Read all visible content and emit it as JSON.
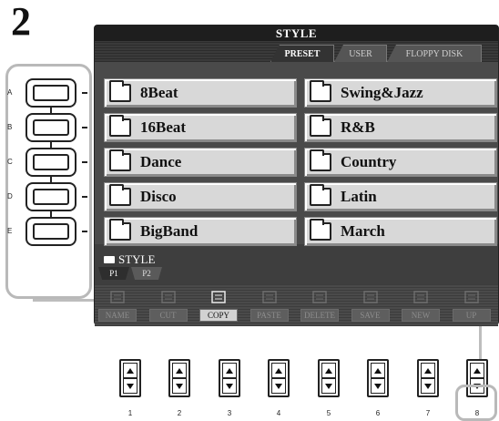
{
  "step": "2",
  "side_buttons": [
    {
      "letter": "A"
    },
    {
      "letter": "B"
    },
    {
      "letter": "C"
    },
    {
      "letter": "D"
    },
    {
      "letter": "E"
    }
  ],
  "screen": {
    "title": "STYLE",
    "tabs": [
      {
        "label": "PRESET",
        "active": true
      },
      {
        "label": "USER",
        "active": false
      },
      {
        "label": "FLOPPY DISK",
        "active": false
      }
    ],
    "styles_left": [
      "8Beat",
      "16Beat",
      "Dance",
      "Disco",
      "BigBand"
    ],
    "styles_right": [
      "Swing&Jazz",
      "R&B",
      "Country",
      "Latin",
      "March"
    ],
    "path": "STYLE",
    "pages": [
      {
        "label": "P1",
        "active": true
      },
      {
        "label": "P2",
        "active": false
      }
    ],
    "functions": [
      {
        "label": "NAME",
        "icon": "name-icon",
        "active": false
      },
      {
        "label": "CUT",
        "icon": "scissors-icon",
        "active": false
      },
      {
        "label": "COPY",
        "icon": "copy-icon",
        "active": true
      },
      {
        "label": "PASTE",
        "icon": "paste-icon",
        "active": false
      },
      {
        "label": "DELETE",
        "icon": "trash-icon",
        "active": false
      },
      {
        "label": "SAVE",
        "icon": "save-icon",
        "active": false
      },
      {
        "label": "NEW",
        "icon": "new-folder-icon",
        "active": false
      },
      {
        "label": "UP",
        "icon": "up-folder-icon",
        "active": false
      }
    ]
  },
  "bottom_buttons": [
    "1",
    "2",
    "3",
    "4",
    "5",
    "6",
    "7",
    "8"
  ],
  "colors": {
    "screen_bg": "#3e3e3e",
    "button_face": "#d8d8d8",
    "highlight": "#bdbdbd"
  }
}
